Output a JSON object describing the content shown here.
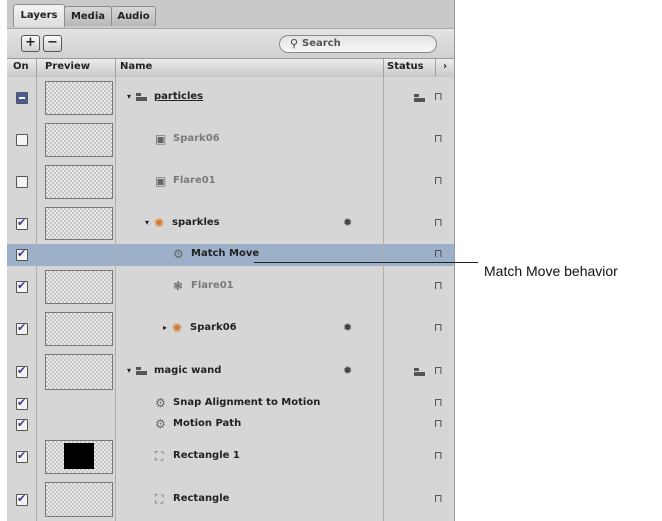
{
  "tabs": [
    {
      "label": "Layers",
      "active": true
    },
    {
      "label": "Media",
      "active": false
    },
    {
      "label": "Audio",
      "active": false
    }
  ],
  "toolbar": {
    "add_label": "+",
    "remove_label": "−",
    "search_placeholder": "Search",
    "search_icon": "magnifier-icon"
  },
  "columns": {
    "on": "On",
    "preview": "Preview",
    "name": "Name",
    "status": "Status",
    "more": "›"
  },
  "rows": [
    {
      "name": "particles",
      "checkbox": "mixed",
      "preview": "checker",
      "icon": "group-icon",
      "expander": "▾",
      "underlined": true,
      "status_group_icon": true
    },
    {
      "name": "Spark06",
      "checkbox": "unchecked",
      "preview": "checker",
      "icon": "image-icon",
      "dim": true
    },
    {
      "name": "Flare01",
      "checkbox": "unchecked",
      "preview": "checker",
      "icon": "image-icon",
      "dim": true
    },
    {
      "name": "sparkles",
      "checkbox": "checked",
      "preview": "checker",
      "icon": "emitter-icon",
      "expander": "▾",
      "gear": true
    },
    {
      "name": "Match Move",
      "checkbox": "checked",
      "preview": "none",
      "icon": "behavior-icon",
      "selected": true
    },
    {
      "name": "Flare01",
      "checkbox": "checked",
      "preview": "checker",
      "icon": "cell-icon",
      "dim": true
    },
    {
      "name": "Spark06",
      "checkbox": "checked",
      "preview": "checker",
      "icon": "emitter-icon",
      "expander": "▸",
      "gear": true
    },
    {
      "name": "magic wand",
      "checkbox": "checked",
      "preview": "checker",
      "icon": "group-icon",
      "expander": "▾",
      "gear": true,
      "status_group_icon": true
    },
    {
      "name": "Snap Alignment to Motion",
      "checkbox": "checked",
      "preview": "none",
      "icon": "behavior-icon"
    },
    {
      "name": "Motion Path",
      "checkbox": "checked",
      "preview": "none",
      "icon": "behavior-icon"
    },
    {
      "name": "Rectangle 1",
      "checkbox": "checked",
      "preview": "black",
      "icon": "shape-icon"
    },
    {
      "name": "Rectangle",
      "checkbox": "checked",
      "preview": "checker",
      "icon": "shape-icon"
    }
  ],
  "callout": {
    "label": "Match Move behavior"
  },
  "colors": {
    "panel": "#d5d5d5",
    "selected_row": "#9db0ca",
    "particle_icon": "#d3782e"
  }
}
